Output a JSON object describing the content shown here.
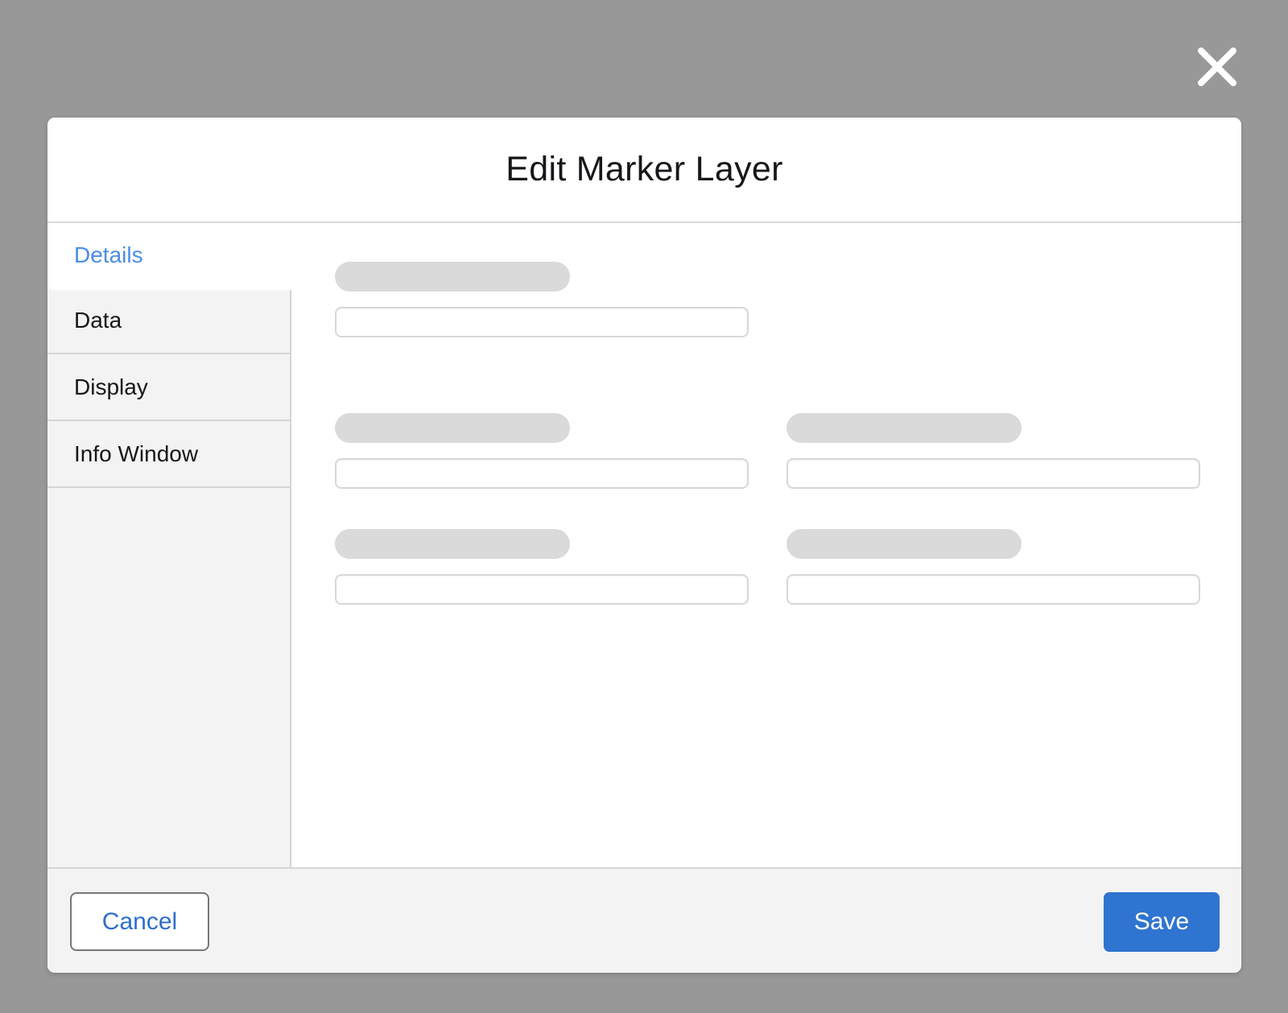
{
  "overlay": {
    "close_icon": "close-icon",
    "background_color": "#989898"
  },
  "modal": {
    "title": "Edit Marker Layer"
  },
  "sidebar": {
    "items": [
      {
        "label": "Details",
        "active": true
      },
      {
        "label": "Data",
        "active": false
      },
      {
        "label": "Display",
        "active": false
      },
      {
        "label": "Info Window",
        "active": false
      }
    ]
  },
  "footer": {
    "cancel_label": "Cancel",
    "save_label": "Save"
  },
  "colors": {
    "accent": "#2f74d0",
    "active_tab_text": "#4b8ee6",
    "skeleton": "#dadada"
  }
}
